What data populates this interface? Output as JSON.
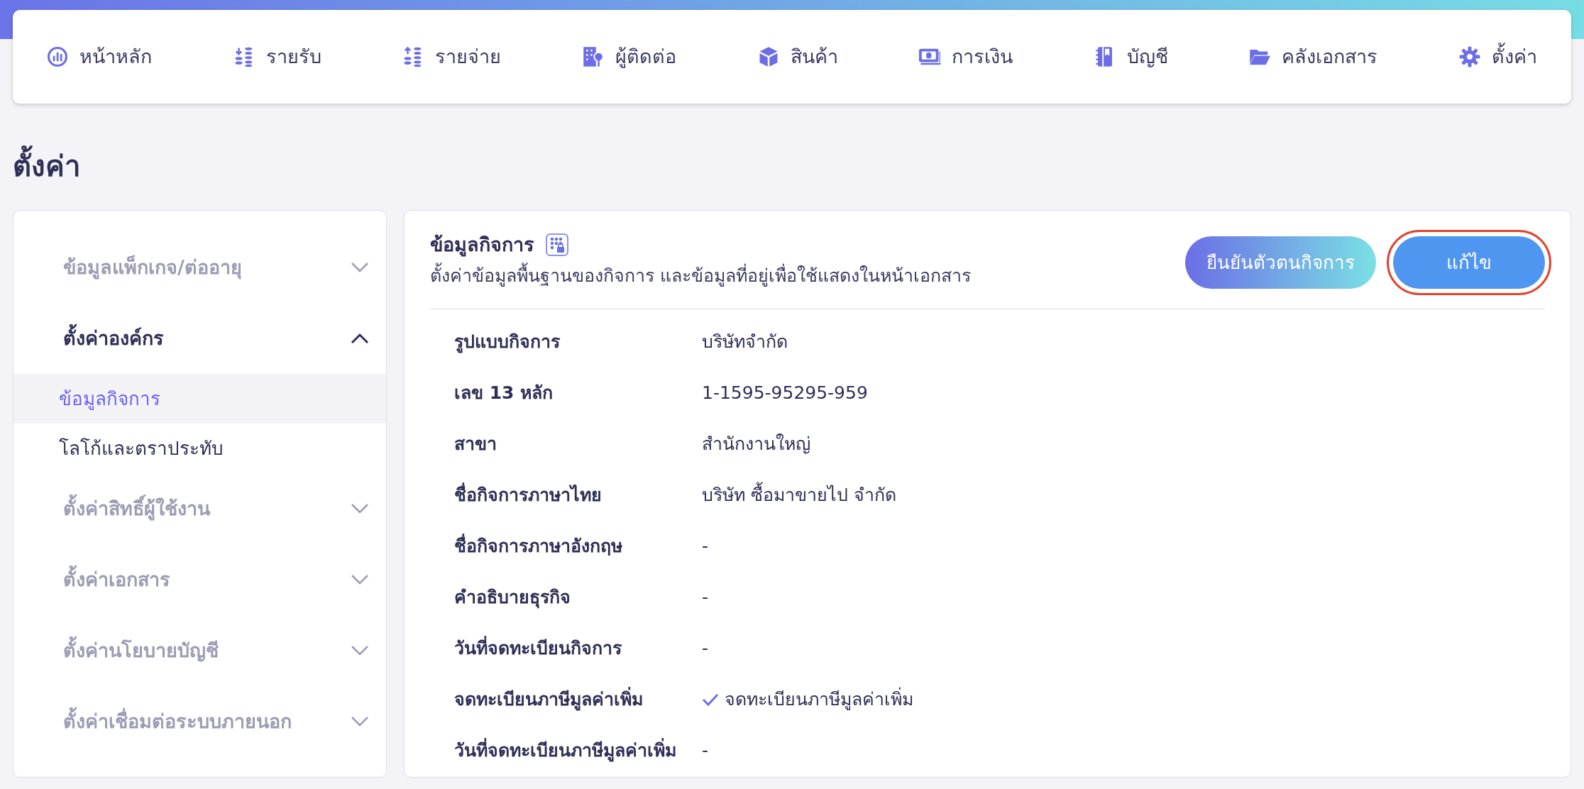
{
  "nav": [
    {
      "label": "หน้าหลัก"
    },
    {
      "label": "รายรับ"
    },
    {
      "label": "รายจ่าย"
    },
    {
      "label": "ผู้ติดต่อ"
    },
    {
      "label": "สินค้า"
    },
    {
      "label": "การเงิน"
    },
    {
      "label": "บัญชี"
    },
    {
      "label": "คลังเอกสาร"
    },
    {
      "label": "ตั้งค่า"
    }
  ],
  "page_title": "ตั้งค่า",
  "sidebar": {
    "items": [
      {
        "label": "ข้อมูลแพ็กเกจ/ต่ออายุ",
        "expanded": false
      },
      {
        "label": "ตั้งค่าองค์กร",
        "expanded": true,
        "children": [
          {
            "label": "ข้อมูลกิจการ",
            "selected": true
          },
          {
            "label": "โลโก้และตราประทับ",
            "selected": false
          }
        ]
      },
      {
        "label": "ตั้งค่าสิทธิ์ผู้ใช้งาน",
        "expanded": false
      },
      {
        "label": "ตั้งค่าเอกสาร",
        "expanded": false
      },
      {
        "label": "ตั้งค่านโยบายบัญชี",
        "expanded": false
      },
      {
        "label": "ตั้งค่าเชื่อมต่อระบบภายนอก",
        "expanded": false
      }
    ]
  },
  "panel": {
    "title": "ข้อมูลกิจการ",
    "subtitle": "ตั้งค่าข้อมูลพื้นฐานของกิจการ และข้อมูลที่อยู่เพื่อใช้แสดงในหน้าเอกสาร",
    "buttons": [
      {
        "label": "ยืนยันตัวตนกิจการ",
        "kind": "gradient",
        "highlighted": false
      },
      {
        "label": "แก้ไข",
        "kind": "primary",
        "highlighted": true
      }
    ],
    "rows": [
      {
        "label": "รูปแบบกิจการ",
        "value": "บริษัทจำกัด",
        "kind": "text"
      },
      {
        "label": "เลข 13 หลัก",
        "value": "1-1595-95295-959",
        "kind": "text"
      },
      {
        "label": "สาขา",
        "value": "สำนักงานใหญ่",
        "kind": "text"
      },
      {
        "label": "ชื่อกิจการภาษาไทย",
        "value": "บริษัท ซื้อมาขายไป จำกัด",
        "kind": "text"
      },
      {
        "label": "ชื่อกิจการภาษาอังกฤษ",
        "value": "-",
        "kind": "text"
      },
      {
        "label": "คำอธิบายธุรกิจ",
        "value": "-",
        "kind": "text"
      },
      {
        "label": "วันที่จดทะเบียนกิจการ",
        "value": "-",
        "kind": "text"
      },
      {
        "label": "จดทะเบียนภาษีมูลค่าเพิ่ม",
        "value": "จดทะเบียนภาษีมูลค่าเพิ่ม",
        "kind": "check"
      },
      {
        "label": "วันที่จดทะเบียนภาษีมูลค่าเพิ่ม",
        "value": "-",
        "kind": "text"
      }
    ]
  }
}
